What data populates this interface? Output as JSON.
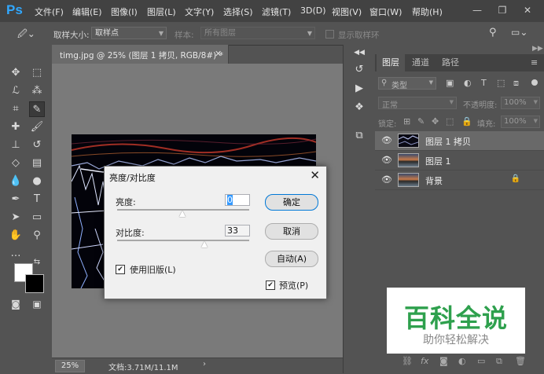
{
  "app": {
    "logo": "Ps"
  },
  "menu": [
    "文件(F)",
    "编辑(E)",
    "图像(I)",
    "图层(L)",
    "文字(Y)",
    "选择(S)",
    "滤镜(T)",
    "3D(D)",
    "视图(V)",
    "窗口(W)",
    "帮助(H)"
  ],
  "options_bar": {
    "sample_size_label": "取样大小:",
    "sample_size_value": "取样点",
    "sample_label": "样本:",
    "sample_value": "所有图层",
    "show_ring_label": "显示取样环"
  },
  "document": {
    "tab_label": "timg.jpg @ 25% (图层 1 拷贝, RGB/8#) *",
    "zoom": "25%",
    "doc_size": "文档:3.71M/11.1M"
  },
  "panel": {
    "tabs": [
      "图层",
      "通道",
      "路径"
    ],
    "filter_label": "类型",
    "blend_mode": "正常",
    "opacity_label": "不透明度:",
    "opacity_value": "100%",
    "lock_label": "锁定:",
    "fill_label": "填充:",
    "fill_value": "100%",
    "layers": [
      {
        "name": "图层 1 拷贝",
        "selected": true,
        "locked": false
      },
      {
        "name": "图层 1",
        "selected": false,
        "locked": false
      },
      {
        "name": "背景",
        "selected": false,
        "locked": true
      }
    ]
  },
  "dialog": {
    "title": "亮度/对比度",
    "brightness_label": "亮度:",
    "brightness_value": "0",
    "contrast_label": "对比度:",
    "contrast_value": "33",
    "use_legacy_label": "使用旧版(L)",
    "use_legacy_checked": true,
    "preview_label": "预览(P)",
    "preview_checked": true,
    "ok_label": "确定",
    "cancel_label": "取消",
    "auto_label": "自动(A)"
  },
  "watermark": {
    "main": "百科全说",
    "sub": "助你轻松解决"
  },
  "colors": {
    "ps_blue": "#31a8ff",
    "watermark_green": "#2ea04d"
  }
}
